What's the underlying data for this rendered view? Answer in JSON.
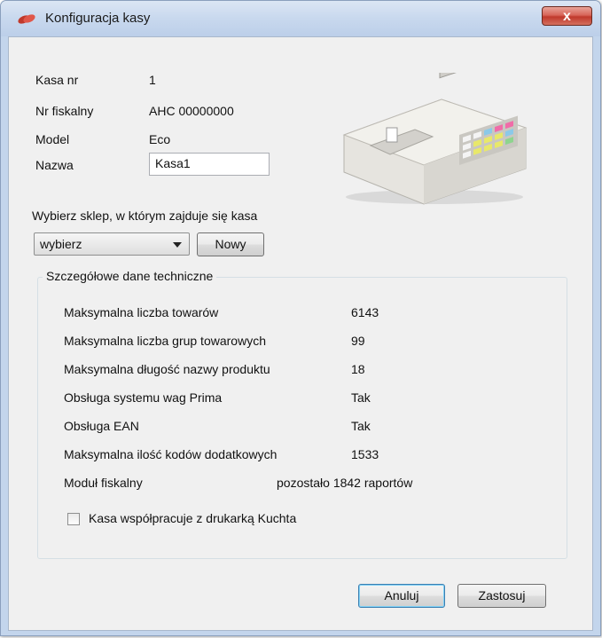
{
  "window": {
    "title": "Konfiguracja kasy",
    "close_label": "x"
  },
  "info": [
    {
      "label": "Kasa nr",
      "value": "1"
    },
    {
      "label": "Nr fiskalny",
      "value": "AHC 00000000"
    },
    {
      "label": "Model",
      "value": "Eco"
    }
  ],
  "name_field": {
    "label": "Nazwa",
    "value": "Kasa1"
  },
  "shop": {
    "label": "Wybierz sklep, w którym zajduje się kasa",
    "selected": "wybierz",
    "new_button": "Nowy"
  },
  "details": {
    "title": "Szczegółowe dane techniczne",
    "rows": [
      {
        "label": "Maksymalna liczba towarów",
        "value": "6143"
      },
      {
        "label": "Maksymalna liczba grup towarowych",
        "value": "99"
      },
      {
        "label": "Maksymalna długość nazwy produktu",
        "value": "18"
      },
      {
        "label": "Obsługa systemu wag Prima",
        "value": "Tak"
      },
      {
        "label": "Obsługa EAN",
        "value": "Tak"
      },
      {
        "label": "Maksymalna ilość kodów dodatkowych",
        "value": "1533"
      },
      {
        "label": "Moduł fiskalny",
        "value": "pozostało 1842 raportów"
      }
    ],
    "checkbox_label": "Kasa współpracuje z drukarką Kuchta",
    "checkbox_checked": false
  },
  "buttons": {
    "cancel": "Anuluj",
    "apply": "Zastosuj"
  },
  "icons": {
    "app": "cash-register-app-icon",
    "image": "cash-register-illustration"
  }
}
